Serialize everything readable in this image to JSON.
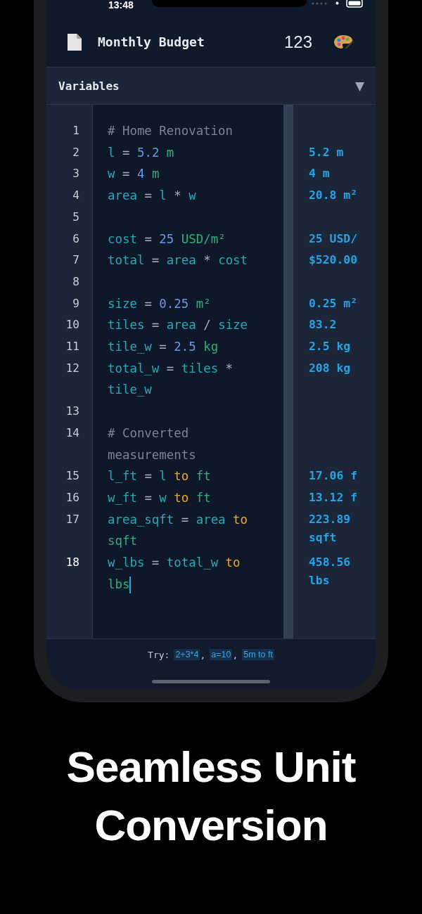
{
  "status_bar": {
    "time": "13:48"
  },
  "header": {
    "title": "Monthly Budget",
    "count": "123"
  },
  "variables_bar": {
    "label": "Variables",
    "toggle": "▼"
  },
  "lines": [
    {
      "number": "1",
      "caret": false,
      "tokens": [
        {
          "text": "# Home Renovation",
          "kind": "comment"
        }
      ]
    },
    {
      "number": "2",
      "caret": false,
      "tokens": [
        {
          "text": "l",
          "kind": "var"
        },
        {
          "text": "=",
          "kind": "op"
        },
        {
          "text": "5.2",
          "kind": "num"
        },
        {
          "text": "m",
          "kind": "unit"
        }
      ],
      "result": "5.2 m"
    },
    {
      "number": "3",
      "caret": false,
      "tokens": [
        {
          "text": "w",
          "kind": "var"
        },
        {
          "text": "=",
          "kind": "op"
        },
        {
          "text": "4",
          "kind": "num"
        },
        {
          "text": "m",
          "kind": "unit"
        }
      ],
      "result": "4 m"
    },
    {
      "number": "4",
      "caret": false,
      "tokens": [
        {
          "text": "area",
          "kind": "var"
        },
        {
          "text": "=",
          "kind": "op"
        },
        {
          "text": "l",
          "kind": "var"
        },
        {
          "text": "*",
          "kind": "op"
        },
        {
          "text": "w",
          "kind": "var"
        }
      ],
      "result": "20.8 m²"
    },
    {
      "number": "5",
      "caret": false
    },
    {
      "number": "6",
      "caret": false,
      "tokens": [
        {
          "text": "cost",
          "kind": "var"
        },
        {
          "text": "=",
          "kind": "op"
        },
        {
          "text": "25",
          "kind": "num"
        },
        {
          "text": "USD/m²",
          "kind": "unit"
        }
      ],
      "result": "25 USD/"
    },
    {
      "number": "7",
      "caret": false,
      "tokens": [
        {
          "text": "total",
          "kind": "var"
        },
        {
          "text": "=",
          "kind": "op"
        },
        {
          "text": "area",
          "kind": "var"
        },
        {
          "text": "*",
          "kind": "op"
        },
        {
          "text": "cost",
          "kind": "var"
        }
      ],
      "result": "$520.00"
    },
    {
      "number": "8",
      "caret": false
    },
    {
      "number": "9",
      "caret": false,
      "tokens": [
        {
          "text": "size",
          "kind": "var"
        },
        {
          "text": "=",
          "kind": "op"
        },
        {
          "text": "0.25",
          "kind": "num"
        },
        {
          "text": "m²",
          "kind": "unit"
        }
      ],
      "result": "0.25 m²"
    },
    {
      "number": "10",
      "caret": false,
      "tokens": [
        {
          "text": "tiles",
          "kind": "var"
        },
        {
          "text": "=",
          "kind": "op"
        },
        {
          "text": "area",
          "kind": "var"
        },
        {
          "text": "/",
          "kind": "op"
        },
        {
          "text": "size",
          "kind": "var"
        }
      ],
      "result": "83.2"
    },
    {
      "number": "11",
      "caret": false,
      "tokens": [
        {
          "text": "tile_w",
          "kind": "var"
        },
        {
          "text": "=",
          "kind": "op"
        },
        {
          "text": "2.5",
          "kind": "num"
        },
        {
          "text": "kg",
          "kind": "unit"
        }
      ],
      "result": "2.5 kg"
    },
    {
      "number": "12",
      "caret": false,
      "tokens": [
        {
          "text": "total_w",
          "kind": "var"
        },
        {
          "text": "=",
          "kind": "op"
        },
        {
          "text": "tiles",
          "kind": "var"
        },
        {
          "text": "*",
          "kind": "op"
        },
        {
          "text": "tile_w",
          "kind": "var"
        }
      ],
      "result": "208 kg"
    },
    {
      "number": "13",
      "caret": false
    },
    {
      "number": "14",
      "caret": false,
      "tokens": [
        {
          "text": "# Converted measurements",
          "kind": "comment"
        }
      ]
    },
    {
      "number": "15",
      "caret": false,
      "tokens": [
        {
          "text": "l_ft",
          "kind": "var"
        },
        {
          "text": "=",
          "kind": "op"
        },
        {
          "text": "l",
          "kind": "var"
        },
        {
          "text": "to",
          "kind": "keyword"
        },
        {
          "text": "ft",
          "kind": "unit"
        }
      ],
      "result": "17.06 f"
    },
    {
      "number": "16",
      "caret": false,
      "tokens": [
        {
          "text": "w_ft",
          "kind": "var"
        },
        {
          "text": "=",
          "kind": "op"
        },
        {
          "text": "w",
          "kind": "var"
        },
        {
          "text": "to",
          "kind": "keyword"
        },
        {
          "text": "ft",
          "kind": "unit"
        }
      ],
      "result": "13.12 f"
    },
    {
      "number": "17",
      "caret": false,
      "tokens": [
        {
          "text": "area_sqft",
          "kind": "var"
        },
        {
          "text": "=",
          "kind": "op"
        },
        {
          "text": "area",
          "kind": "var"
        },
        {
          "text": "to",
          "kind": "keyword"
        },
        {
          "text": "sqft",
          "kind": "unit"
        }
      ],
      "result": "223.89 sqft"
    },
    {
      "number": "18",
      "caret": true,
      "tokens": [
        {
          "text": "w_lbs",
          "kind": "var"
        },
        {
          "text": "=",
          "kind": "op"
        },
        {
          "text": "total_w",
          "kind": "var"
        },
        {
          "text": "to",
          "kind": "keyword"
        },
        {
          "text": "lbs",
          "kind": "unit"
        }
      ],
      "result": "458.56 lbs"
    }
  ],
  "footer": {
    "label": "Try:",
    "examples": [
      {
        "text": "2+3*4",
        "suffix": ","
      },
      {
        "text": "a=10",
        "suffix": ","
      },
      {
        "text": "5m to ft"
      }
    ]
  },
  "headline": [
    "Seamless Unit",
    "Conversion"
  ]
}
